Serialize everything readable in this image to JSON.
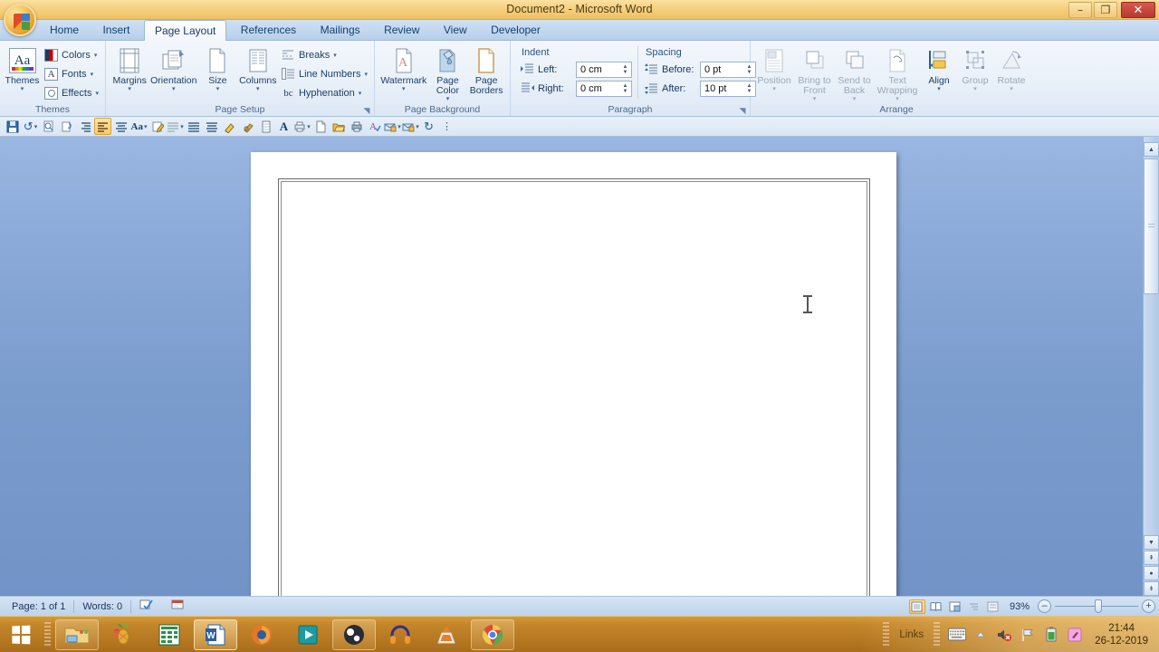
{
  "window": {
    "title": "Document2 - Microsoft Word",
    "controls": {
      "minimize": "–",
      "restore": "❐",
      "close": "✕",
      "minimize_name": "minimize",
      "restore_name": "restore",
      "close_name": "close"
    }
  },
  "office_button": {
    "label": "Office"
  },
  "tabs": [
    {
      "label": "Home",
      "active": false
    },
    {
      "label": "Insert",
      "active": false
    },
    {
      "label": "Page Layout",
      "active": true
    },
    {
      "label": "References",
      "active": false
    },
    {
      "label": "Mailings",
      "active": false
    },
    {
      "label": "Review",
      "active": false
    },
    {
      "label": "View",
      "active": false
    },
    {
      "label": "Developer",
      "active": false
    }
  ],
  "ribbon": {
    "groups": [
      {
        "name": "Themes",
        "label": "Themes"
      },
      {
        "name": "Page Setup",
        "label": "Page Setup"
      },
      {
        "name": "Page Background",
        "label": "Page Background"
      },
      {
        "name": "Paragraph",
        "label": "Paragraph"
      },
      {
        "name": "Arrange",
        "label": "Arrange"
      }
    ],
    "themes": {
      "big": {
        "label": "Themes",
        "drop": "▾"
      },
      "items": [
        {
          "label": "Colors",
          "drop": "▾",
          "icon": "theme-colors-icon"
        },
        {
          "label": "Fonts",
          "drop": "▾",
          "icon": "theme-fonts-icon",
          "glyph": "A"
        },
        {
          "label": "Effects",
          "drop": "▾",
          "icon": "theme-effects-icon"
        }
      ]
    },
    "page_setup": {
      "big": [
        {
          "label": "Margins",
          "drop": "▾",
          "icon": "margins-icon"
        },
        {
          "label": "Orientation",
          "drop": "▾",
          "icon": "orientation-icon"
        },
        {
          "label": "Size",
          "drop": "▾",
          "icon": "size-icon"
        },
        {
          "label": "Columns",
          "drop": "▾",
          "icon": "columns-icon"
        }
      ],
      "small": [
        {
          "label": "Breaks",
          "drop": "▾",
          "icon": "breaks-icon"
        },
        {
          "label": "Line Numbers",
          "drop": "▾",
          "icon": "line-numbers-icon"
        },
        {
          "label": "Hyphenation",
          "drop": "▾",
          "icon": "hyphenation-icon",
          "glyph": "bc"
        }
      ],
      "launcher": "◥"
    },
    "page_background": {
      "big": [
        {
          "label": "Watermark",
          "drop": "▾",
          "icon": "watermark-icon"
        },
        {
          "label": "Page Color",
          "drop": "▾",
          "icon": "page-color-icon"
        },
        {
          "label": "Page Borders",
          "drop": "",
          "icon": "page-borders-icon"
        }
      ]
    },
    "paragraph": {
      "indent": {
        "title": "Indent",
        "fields": [
          {
            "label": "Left:",
            "value": "0 cm",
            "icon": "indent-left-icon"
          },
          {
            "label": "Right:",
            "value": "0 cm",
            "icon": "indent-right-icon"
          }
        ]
      },
      "spacing": {
        "title": "Spacing",
        "fields": [
          {
            "label": "Before:",
            "value": "0 pt",
            "icon": "spacing-before-icon"
          },
          {
            "label": "After:",
            "value": "10 pt",
            "icon": "spacing-after-icon"
          }
        ]
      },
      "launcher": "◥"
    },
    "arrange": {
      "big": [
        {
          "label": "Position",
          "drop": "▾",
          "icon": "position-icon",
          "disabled": true
        },
        {
          "label": "Bring to Front",
          "drop": "▾",
          "icon": "bring-to-front-icon",
          "disabled": true
        },
        {
          "label": "Send to Back",
          "drop": "▾",
          "icon": "send-to-back-icon",
          "disabled": true
        },
        {
          "label": "Text Wrapping",
          "drop": "▾",
          "icon": "text-wrapping-icon",
          "disabled": true
        },
        {
          "label": "Align",
          "drop": "▾",
          "icon": "align-icon",
          "disabled": false
        },
        {
          "label": "Group",
          "drop": "▾",
          "icon": "group-icon",
          "disabled": true
        },
        {
          "label": "Rotate",
          "drop": "▾",
          "icon": "rotate-icon",
          "disabled": true
        }
      ]
    }
  },
  "quick_toolbar": {
    "buttons": [
      {
        "icon": "save-icon",
        "glyph": "💾",
        "active": false,
        "drop": false
      },
      {
        "icon": "undo-icon",
        "glyph": "↺",
        "active": false,
        "drop": true
      },
      {
        "icon": "print-preview-icon",
        "glyph": "🔍",
        "active": false,
        "drop": false
      },
      {
        "icon": "attach-icon",
        "glyph": "📎",
        "active": false,
        "drop": false
      },
      {
        "icon": "align-right-icon",
        "glyph": "≡",
        "active": false,
        "drop": false
      },
      {
        "icon": "align-left-icon",
        "glyph": "≡",
        "active": true,
        "drop": false
      },
      {
        "icon": "align-center-icon",
        "glyph": "≡",
        "active": false,
        "drop": false
      },
      {
        "icon": "change-case-icon",
        "glyph": "Aa",
        "active": false,
        "drop": true
      },
      {
        "icon": "edit-icon",
        "glyph": "✎",
        "active": false,
        "drop": false
      },
      {
        "icon": "paragraph-marks-icon",
        "glyph": "≣",
        "active": false,
        "drop": true
      },
      {
        "icon": "justify-icon",
        "glyph": "≡",
        "active": false,
        "drop": false
      },
      {
        "icon": "distribute-icon",
        "glyph": "≡",
        "active": false,
        "drop": false
      },
      {
        "icon": "format-painter-icon",
        "glyph": "🖌",
        "active": false,
        "drop": false
      },
      {
        "icon": "highlight-icon",
        "glyph": "✐",
        "active": false,
        "drop": false
      },
      {
        "icon": "borders-icon",
        "glyph": "▤",
        "active": false,
        "drop": false
      },
      {
        "icon": "font-icon",
        "glyph": "A",
        "active": false,
        "drop": false
      },
      {
        "icon": "print-icon",
        "glyph": "🖶",
        "active": false,
        "drop": true
      },
      {
        "icon": "new-document-icon",
        "glyph": "🗋",
        "active": false,
        "drop": false
      },
      {
        "icon": "open-icon",
        "glyph": "📂",
        "active": false,
        "drop": false
      },
      {
        "icon": "quick-print-icon",
        "glyph": "🖨",
        "active": false,
        "drop": false
      },
      {
        "icon": "spelling-icon",
        "glyph": "A",
        "active": false,
        "drop": false
      },
      {
        "icon": "mail-merge-icon",
        "glyph": "✉",
        "active": false,
        "drop": true
      },
      {
        "icon": "mail-recipients-icon",
        "glyph": "✉",
        "active": false,
        "drop": true
      },
      {
        "icon": "redo-icon",
        "glyph": "↻",
        "active": false,
        "drop": false
      },
      {
        "icon": "toolbar-options-icon",
        "glyph": "⋮",
        "active": false,
        "drop": false
      }
    ]
  },
  "document": {
    "zoom_level": "93%",
    "cursor": "text-ibeam"
  },
  "statusbar": {
    "page": "Page: 1 of 1",
    "words": "Words: 0",
    "proofing_icon": "spelling-check-icon",
    "language_icon": "insert-object-icon",
    "view_buttons": [
      {
        "name": "print-layout-view",
        "glyph": "▤",
        "active": true
      },
      {
        "name": "full-screen-reading-view",
        "glyph": "▥",
        "active": false
      },
      {
        "name": "web-layout-view",
        "glyph": "▦",
        "active": false
      },
      {
        "name": "outline-view",
        "glyph": "▧",
        "active": false
      },
      {
        "name": "draft-view",
        "glyph": "▨",
        "active": false
      }
    ],
    "zoom_out": "–",
    "zoom_in": "+",
    "zoom_value": "93%"
  },
  "scrollbar": {
    "up_arrow": "▲",
    "down_arrow": "▼",
    "split_arrow": "▲",
    "previous_page": "⇞",
    "select_browse_object": "●",
    "next_page": "⇟"
  },
  "taskbar": {
    "start": "start-button",
    "items": [
      {
        "name": "file-explorer",
        "label": "File Explorer",
        "active": false,
        "pinned": true
      },
      {
        "name": "pineapple-app",
        "label": "Pineapple App",
        "active": false,
        "pinned": false
      },
      {
        "name": "excel",
        "label": "Microsoft Excel",
        "active": false,
        "pinned": false
      },
      {
        "name": "word",
        "label": "Microsoft Word",
        "active": true,
        "pinned": false
      },
      {
        "name": "firefox",
        "label": "Mozilla Firefox",
        "active": false,
        "pinned": false
      },
      {
        "name": "media-player",
        "label": "Media Player",
        "active": false,
        "pinned": false
      },
      {
        "name": "obs-studio",
        "label": "OBS Studio",
        "active": false,
        "pinned": true
      },
      {
        "name": "audio-app",
        "label": "Audio App",
        "active": false,
        "pinned": false
      },
      {
        "name": "vlc",
        "label": "VLC Media Player",
        "active": false,
        "pinned": false
      },
      {
        "name": "chrome",
        "label": "Google Chrome",
        "active": false,
        "pinned": true
      }
    ],
    "tray": {
      "links_label": "Links",
      "keyboard_icon": "keyboard-icon",
      "show_hidden_icon": "show-hidden-icons-arrow",
      "volume_icon": "volume-muted-icon",
      "action_center_icon": "action-center-flag-icon",
      "battery_icon": "battery-icon",
      "app_icon": "pink-app-icon",
      "time": "21:44",
      "date": "26-12-2019"
    }
  },
  "colors": {
    "titlebar": "#f2c86f",
    "ribbon": "#eaf1f9",
    "accent_blue": "#16365c",
    "taskbar": "#b87a22",
    "close_red": "#b8392f",
    "desktop_blue": "#7a9ccd"
  }
}
